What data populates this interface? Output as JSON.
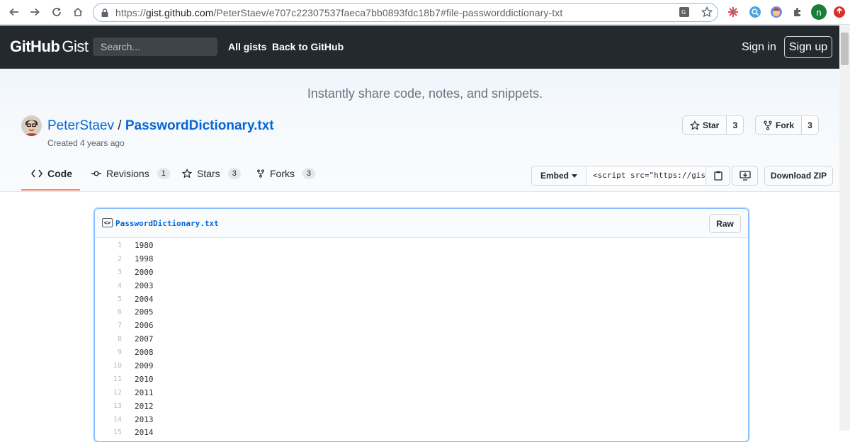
{
  "browser": {
    "url_prefix": "https://",
    "url_host": "gist.github.com",
    "url_path": "/PeterStaev/e707c22307537faeca7bb0893fdc18b7#file-passworddictionary-txt",
    "profile_initial": "n"
  },
  "header": {
    "logo_main": "GitHub",
    "logo_sub": "Gist",
    "search_placeholder": "Search...",
    "all_gists": "All gists",
    "back_to_github": "Back to GitHub",
    "sign_in": "Sign in",
    "sign_up": "Sign up"
  },
  "hero": {
    "tagline": "Instantly share code, notes, and snippets.",
    "author": "PeterStaev",
    "separator": " / ",
    "file_title": "PasswordDictionary.txt",
    "created": "Created 4 years ago",
    "star_label": "Star",
    "star_count": "3",
    "fork_label": "Fork",
    "fork_count": "3"
  },
  "tabs": [
    {
      "label": "Code"
    },
    {
      "label": "Revisions",
      "count": "1"
    },
    {
      "label": "Stars",
      "count": "3"
    },
    {
      "label": "Forks",
      "count": "3"
    }
  ],
  "embed": {
    "label": "Embed",
    "code": "<script src=\"https://gist"
  },
  "download_zip": "Download ZIP",
  "file": {
    "name": "PasswordDictionary.txt",
    "raw": "Raw",
    "lines": [
      {
        "n": "1",
        "v": "1980"
      },
      {
        "n": "2",
        "v": "1998"
      },
      {
        "n": "3",
        "v": "2000"
      },
      {
        "n": "4",
        "v": "2003"
      },
      {
        "n": "5",
        "v": "2004"
      },
      {
        "n": "6",
        "v": "2005"
      },
      {
        "n": "7",
        "v": "2006"
      },
      {
        "n": "8",
        "v": "2007"
      },
      {
        "n": "9",
        "v": "2008"
      },
      {
        "n": "10",
        "v": "2009"
      },
      {
        "n": "11",
        "v": "2010"
      },
      {
        "n": "12",
        "v": "2011"
      },
      {
        "n": "13",
        "v": "2012"
      },
      {
        "n": "14",
        "v": "2013"
      },
      {
        "n": "15",
        "v": "2014"
      }
    ]
  },
  "colors": {
    "header_bg": "#24292e",
    "link_blue": "#0366d6",
    "tab_accent": "#f9826c"
  }
}
